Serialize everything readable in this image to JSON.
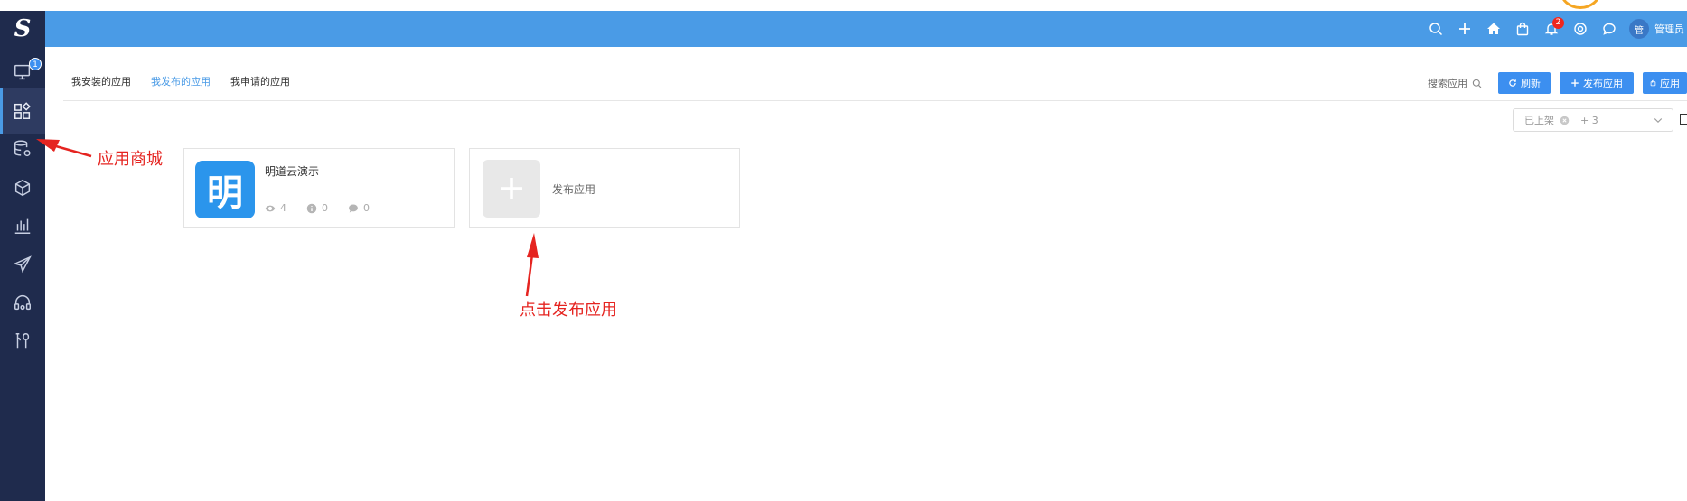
{
  "sidebar": {
    "logo": "S",
    "monitor_badge": "1",
    "items": [
      {
        "name": "monitor-icon"
      },
      {
        "name": "app-store-icon"
      },
      {
        "name": "database-settings-icon"
      },
      {
        "name": "cube-icon"
      },
      {
        "name": "bar-chart-icon"
      },
      {
        "name": "send-icon"
      },
      {
        "name": "support-headset-icon"
      },
      {
        "name": "tools-icon"
      }
    ]
  },
  "header": {
    "notification_badge": "2",
    "avatar_text": "管",
    "username": "管理员"
  },
  "tabs": [
    {
      "label": "我安装的应用"
    },
    {
      "label": "我发布的应用"
    },
    {
      "label": "我申请的应用"
    }
  ],
  "toolbar": {
    "search_label": "搜索应用",
    "refresh_label": "刷新",
    "publish_label": "发布应用",
    "store_label": "应用"
  },
  "filter": {
    "selected": "已上架",
    "extra": "+ 3"
  },
  "apps": [
    {
      "icon_char": "明",
      "name": "明道云演示",
      "views": "4",
      "info": "0",
      "comments": "0"
    }
  ],
  "add_card": {
    "label": "发布应用"
  },
  "annotations": {
    "app_store": "应用商城",
    "click_publish": "点击发布应用"
  },
  "colors": {
    "topbar": "#4a9be6",
    "sidebar": "#1f2b4d",
    "accent": "#3c8ff0",
    "annotation": "#e52420"
  }
}
